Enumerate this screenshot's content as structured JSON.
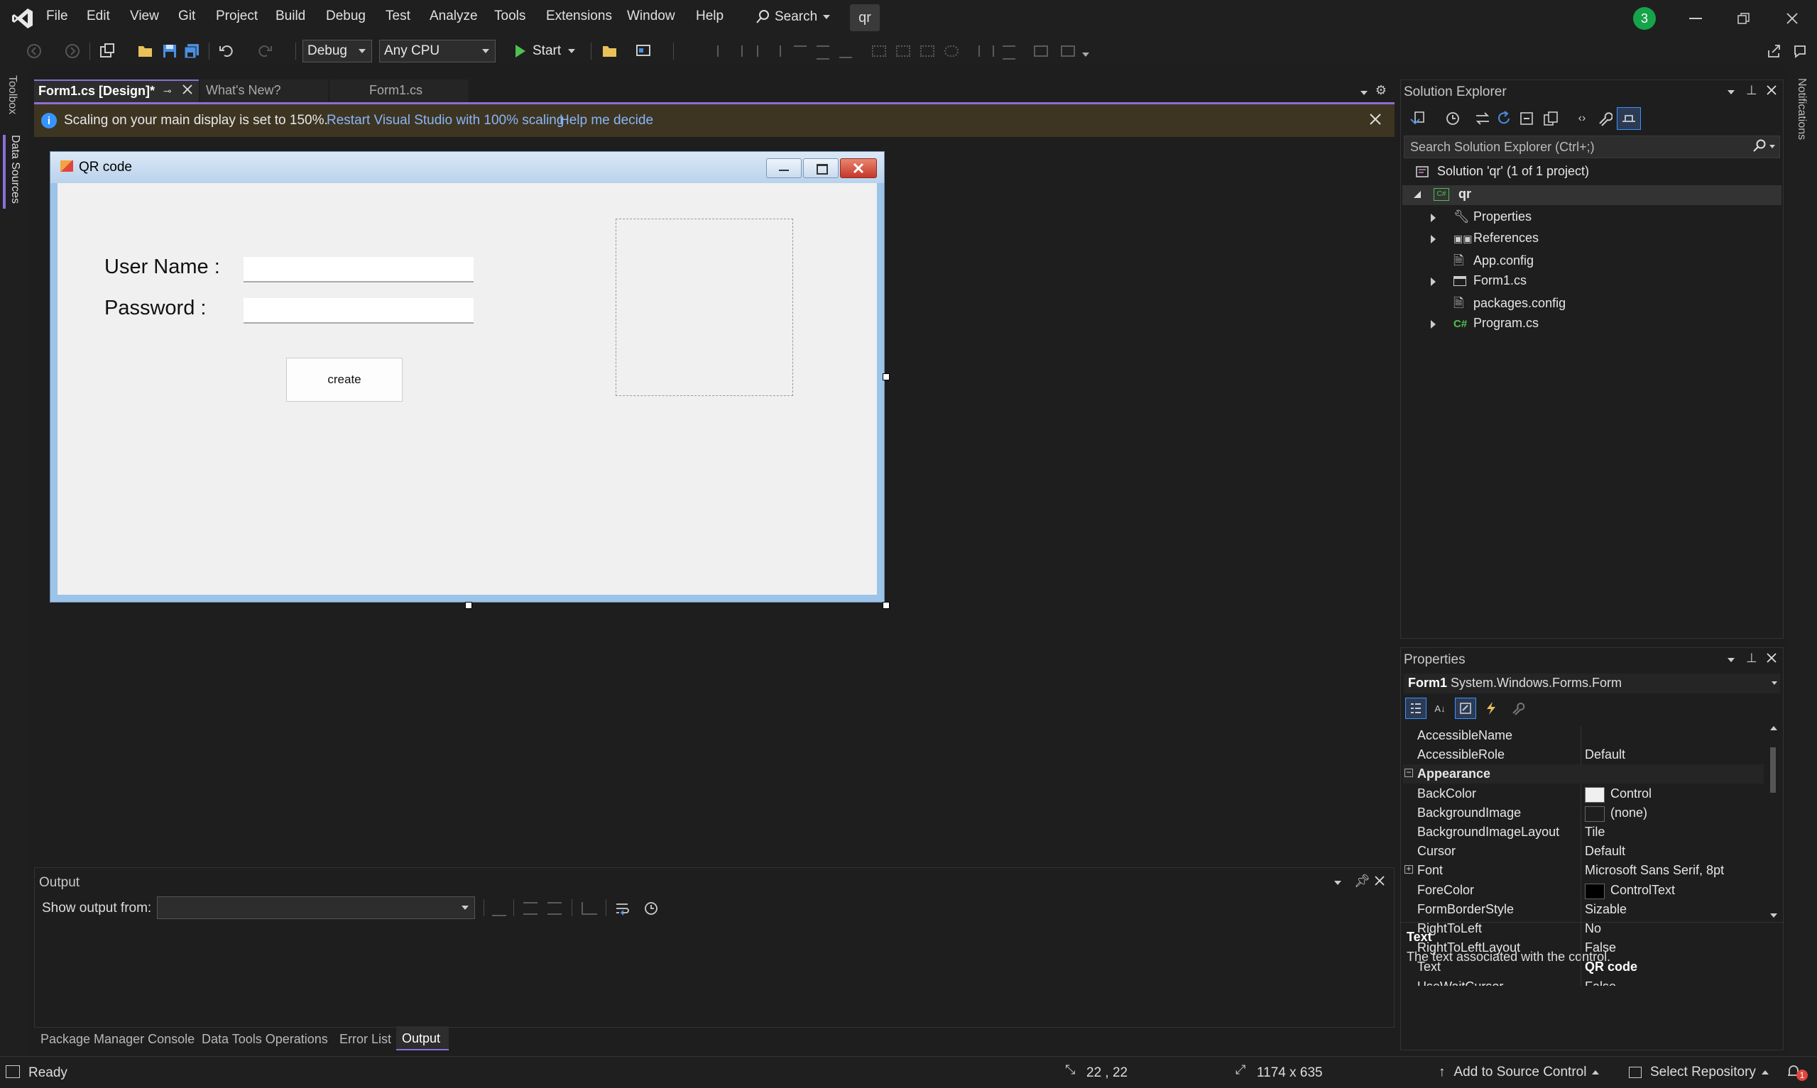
{
  "menu": {
    "items": [
      "File",
      "Edit",
      "View",
      "Git",
      "Project",
      "Build",
      "Debug",
      "Test",
      "Analyze",
      "Tools",
      "Extensions",
      "Window",
      "Help"
    ],
    "search_label": "Search",
    "project_badge": "qr",
    "notification_count": "3"
  },
  "toolbar": {
    "configuration": "Debug",
    "platform": "Any CPU",
    "start_label": "Start"
  },
  "side_tabs": {
    "toolbox": "Toolbox",
    "data_sources": "Data Sources",
    "notifications": "Notifications"
  },
  "doc_tabs": [
    {
      "label": "Form1.cs [Design]*",
      "active": true
    },
    {
      "label": "What's New?",
      "active": false
    },
    {
      "label": "Form1.cs",
      "active": false
    }
  ],
  "infobar": {
    "message": "Scaling on your main display is set to 150%.",
    "link1": "Restart Visual Studio with 100% scaling",
    "link2": "Help me decide"
  },
  "form": {
    "title": "QR code",
    "username_label": "User Name :",
    "password_label": "Password :",
    "button_label": "create"
  },
  "solution_explorer": {
    "title": "Solution Explorer",
    "search_placeholder": "Search Solution Explorer (Ctrl+;)",
    "solution": "Solution 'qr' (1 of 1 project)",
    "project": "qr",
    "items": [
      "Properties",
      "References",
      "App.config",
      "Form1.cs",
      "packages.config",
      "Program.cs"
    ]
  },
  "properties": {
    "title": "Properties",
    "object_name": "Form1",
    "object_type": "System.Windows.Forms.Form",
    "rows": [
      {
        "name": "AccessibleName",
        "value": ""
      },
      {
        "name": "AccessibleRole",
        "value": "Default"
      },
      {
        "name": "Appearance",
        "value": "",
        "category": true
      },
      {
        "name": "BackColor",
        "value": "Control",
        "swatch": "#f0f0f0"
      },
      {
        "name": "BackgroundImage",
        "value": "(none)",
        "swatch": "#1e1e1e"
      },
      {
        "name": "BackgroundImageLayout",
        "value": "Tile"
      },
      {
        "name": "Cursor",
        "value": "Default"
      },
      {
        "name": "Font",
        "value": "Microsoft Sans Serif, 8pt",
        "expand": true
      },
      {
        "name": "ForeColor",
        "value": "ControlText",
        "swatch": "#000000"
      },
      {
        "name": "FormBorderStyle",
        "value": "Sizable"
      },
      {
        "name": "RightToLeft",
        "value": "No"
      },
      {
        "name": "RightToLeftLayout",
        "value": "False"
      },
      {
        "name": "Text",
        "value": "QR code",
        "bold": true
      },
      {
        "name": "UseWaitCursor",
        "value": "False"
      }
    ],
    "desc_title": "Text",
    "desc_text": "The text associated with the control."
  },
  "output": {
    "title": "Output",
    "show_from_label": "Show output from:",
    "show_from_value": ""
  },
  "bottom_tabs": [
    "Package Manager Console",
    "Data Tools Operations",
    "Error List",
    "Output"
  ],
  "status": {
    "ready": "Ready",
    "position": "22 , 22",
    "size": "1174 x 635",
    "source_control": "Add to Source Control",
    "repository": "Select Repository",
    "error_count": "1"
  },
  "colors": {
    "accent": "#8b6fd8",
    "infobar_bg": "#3d3522",
    "link": "#89b4f8",
    "badge": "#16a34a"
  }
}
